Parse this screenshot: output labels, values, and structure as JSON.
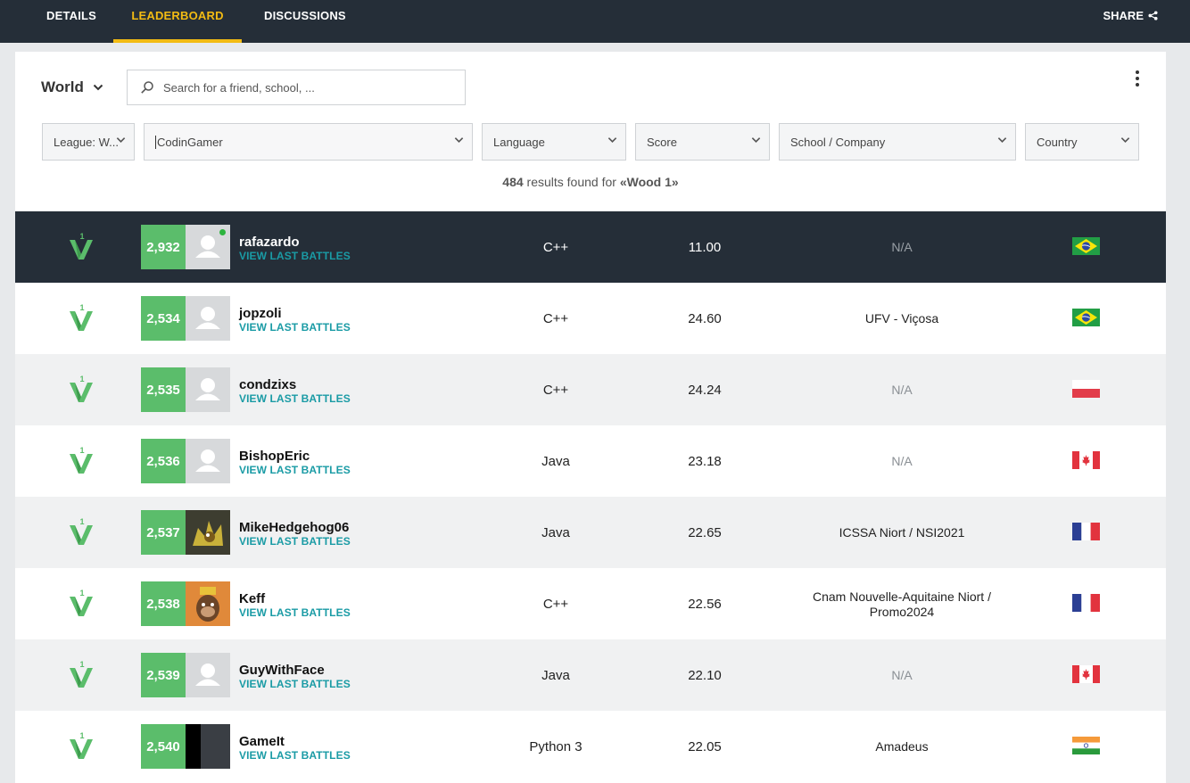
{
  "nav": {
    "tabs": [
      {
        "label": "DETAILS",
        "active": false
      },
      {
        "label": "LEADERBOARD",
        "active": true
      },
      {
        "label": "DISCUSSIONS",
        "active": false
      }
    ],
    "share_label": "SHARE",
    "accent": "#f2bb13"
  },
  "toolbar": {
    "scope": "World",
    "search_placeholder": "Search for a friend, school, ..."
  },
  "filters": {
    "league": "League: W...",
    "codingamer": "CodinGamer",
    "language": "Language",
    "score": "Score",
    "school": "School / Company",
    "country": "Country"
  },
  "results": {
    "count": "484",
    "middle": "results found for",
    "query": "«Wood 1»"
  },
  "rows": [
    {
      "rank": "2,932",
      "name": "rafazardo",
      "battles": "VIEW LAST BATTLES",
      "language": "C++",
      "score": "11.00",
      "school": "N/A",
      "flag": "brazil",
      "league_level": "1",
      "online": true,
      "avatar": "default"
    },
    {
      "rank": "2,534",
      "name": "jopzoli",
      "battles": "VIEW LAST BATTLES",
      "language": "C++",
      "score": "24.60",
      "school": "UFV - Viçosa",
      "flag": "brazil",
      "league_level": "1",
      "avatar": "default"
    },
    {
      "rank": "2,535",
      "name": "condzixs",
      "battles": "VIEW LAST BATTLES",
      "language": "C++",
      "score": "24.24",
      "school": "N/A",
      "flag": "poland",
      "league_level": "1",
      "avatar": "default"
    },
    {
      "rank": "2,536",
      "name": "BishopEric",
      "battles": "VIEW LAST BATTLES",
      "language": "Java",
      "score": "23.18",
      "school": "N/A",
      "flag": "canada",
      "league_level": "1",
      "avatar": "default"
    },
    {
      "rank": "2,537",
      "name": "MikeHedgehog06",
      "battles": "VIEW LAST BATTLES",
      "language": "Java",
      "score": "22.65",
      "school": "ICSSA Niort / NSI2021",
      "flag": "france",
      "league_level": "1",
      "avatar": "hedgehog"
    },
    {
      "rank": "2,538",
      "name": "Keff",
      "battles": "VIEW LAST BATTLES",
      "language": "C++",
      "score": "22.56",
      "school": "Cnam Nouvelle-Aquitaine Niort / Promo2024",
      "flag": "france",
      "league_level": "1",
      "avatar": "ape"
    },
    {
      "rank": "2,539",
      "name": "GuyWithFace",
      "battles": "VIEW LAST BATTLES",
      "language": "Java",
      "score": "22.10",
      "school": "N/A",
      "flag": "canada",
      "league_level": "1",
      "avatar": "default"
    },
    {
      "rank": "2,540",
      "name": "GameIt",
      "battles": "VIEW LAST BATTLES",
      "language": "Python 3",
      "score": "22.05",
      "school": "Amadeus",
      "flag": "india",
      "league_level": "1",
      "avatar": "split"
    }
  ]
}
